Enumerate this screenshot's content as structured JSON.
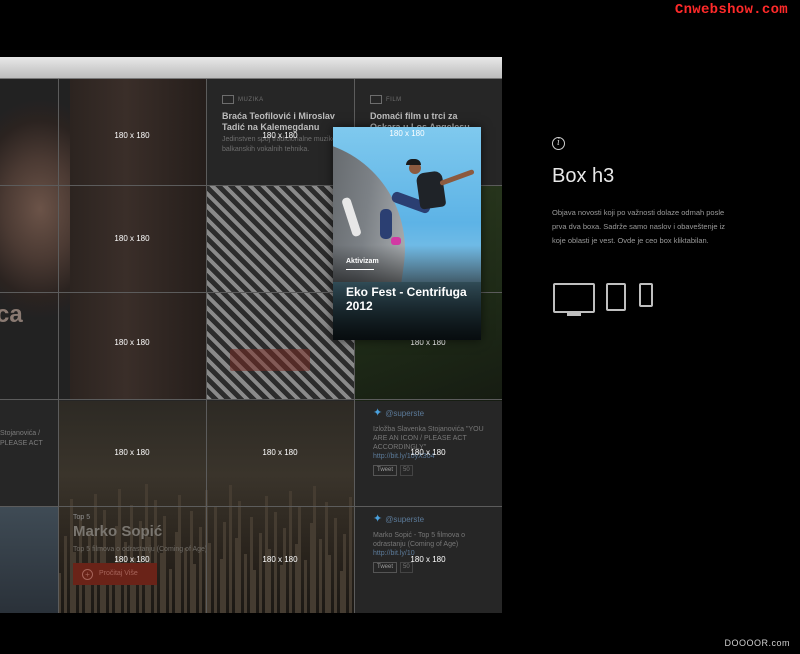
{
  "watermarks": {
    "top": "Cnwebshow.com",
    "bottom": "DOOOOR.com"
  },
  "grid": {
    "cell_label": "180 x 180",
    "news_1": {
      "category": "MUZIKA",
      "title": "Braća Teofilović i Miroslav Tadić na Kalemegdanu",
      "desc": "Jedinstven spoj tradicionalne muzike i balkanskih vokalnih tehnika."
    },
    "news_2": {
      "category": "FILM",
      "title": "Domaći film u trci za Oskara u Los Angelesu",
      "desc": ""
    },
    "hatch_text": "Reklama",
    "tweet_1": {
      "handle": "@superste",
      "text": "Izložba Slavenka Stojanovića \"YOU ARE AN ICON / PLEASE ACT ACCORDINGLY\"",
      "link": "http://bit.ly/10yX304",
      "tweet": "Tweet",
      "count": "50"
    },
    "tweet_2": {
      "handle": "@superste",
      "text": "Marko Sopić - Top 5 filmova o odrastanju (Coming of Age)",
      "link": "http://bit.ly/10",
      "tweet": "Tweet",
      "count": "50"
    },
    "left_tweet_fragment": "Stojanovića / PLEASE ACT",
    "left_title_fragment": "ca",
    "marko": {
      "pre": "Top 5",
      "name": "Marko Sopić",
      "sub": "Top 5 filmova o odrastanju (Coming of Age)",
      "button": "Pročitaj Više"
    }
  },
  "card": {
    "tag": "Aktivizam",
    "title": "Eko Fest - Centrifuga 2012",
    "label": "180 x 180"
  },
  "panel": {
    "info_glyph": "i",
    "title": "Box h3",
    "description": "Objava novosti koji po važnosti dolaze odmah posle prva dva boxa. Sadrže samo naslov i obaveštenje iz koje oblasti je vest. Ovde je ceo box kliktabilan."
  },
  "devices": [
    "desktop-icon",
    "tablet-icon",
    "phone-icon"
  ]
}
